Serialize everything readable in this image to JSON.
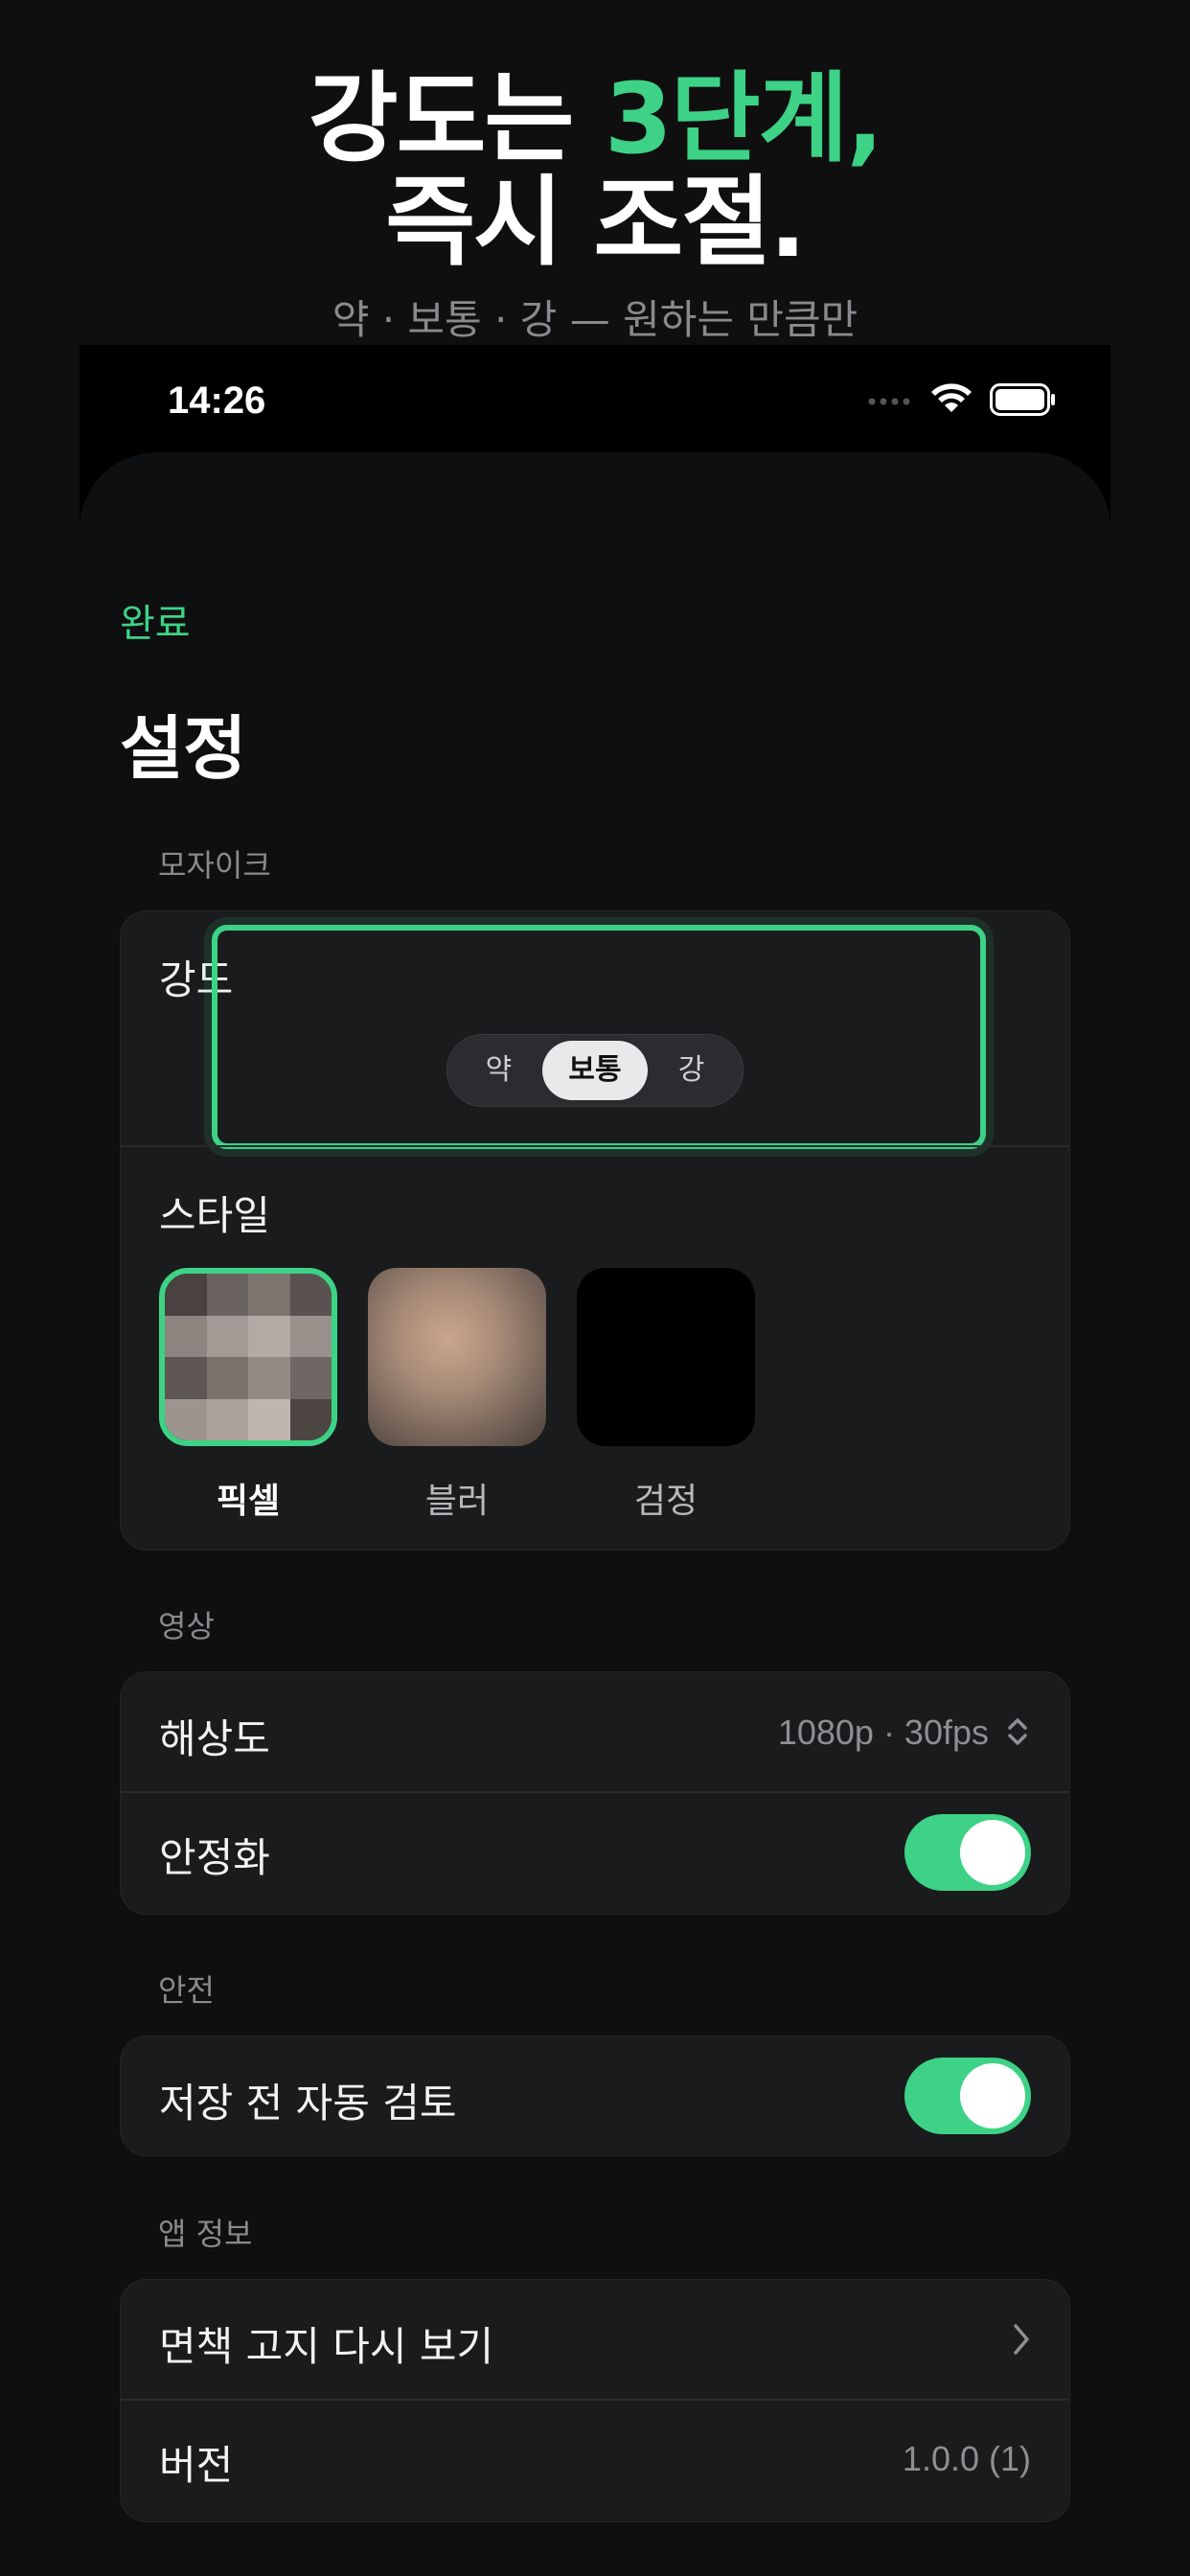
{
  "promo": {
    "headline_line1_part1": "강도는 ",
    "headline_line1_accent": "3단계,",
    "headline_line2": "즉시 조절.",
    "subheadline": "약 · 보통 · 강 — 원하는 만큼만"
  },
  "status_bar": {
    "time": "14:26"
  },
  "nav": {
    "done_label": "완료",
    "title": "설정"
  },
  "sections": {
    "mosaic": {
      "header": "모자이크",
      "strength": {
        "label": "강도",
        "options": [
          "약",
          "보통",
          "강"
        ],
        "selected": "보통"
      },
      "style": {
        "label": "스타일",
        "options": [
          "픽셀",
          "블러",
          "검정"
        ],
        "selected": "픽셀"
      }
    },
    "video": {
      "header": "영상",
      "resolution_label": "해상도",
      "resolution_value": "1080p · 30fps",
      "stabilization_label": "안정화",
      "stabilization_on": true
    },
    "safety": {
      "header": "안전",
      "auto_review_label": "저장 전 자동 검토",
      "auto_review_on": true
    },
    "app_info": {
      "header": "앱 정보",
      "disclaimer_label": "면책 고지 다시 보기",
      "version_label": "버전",
      "version_value": "1.0.0 (1)"
    }
  },
  "colors": {
    "accent": "#3dd286",
    "background": "#0f0f10",
    "card": "#1a1b1d"
  }
}
